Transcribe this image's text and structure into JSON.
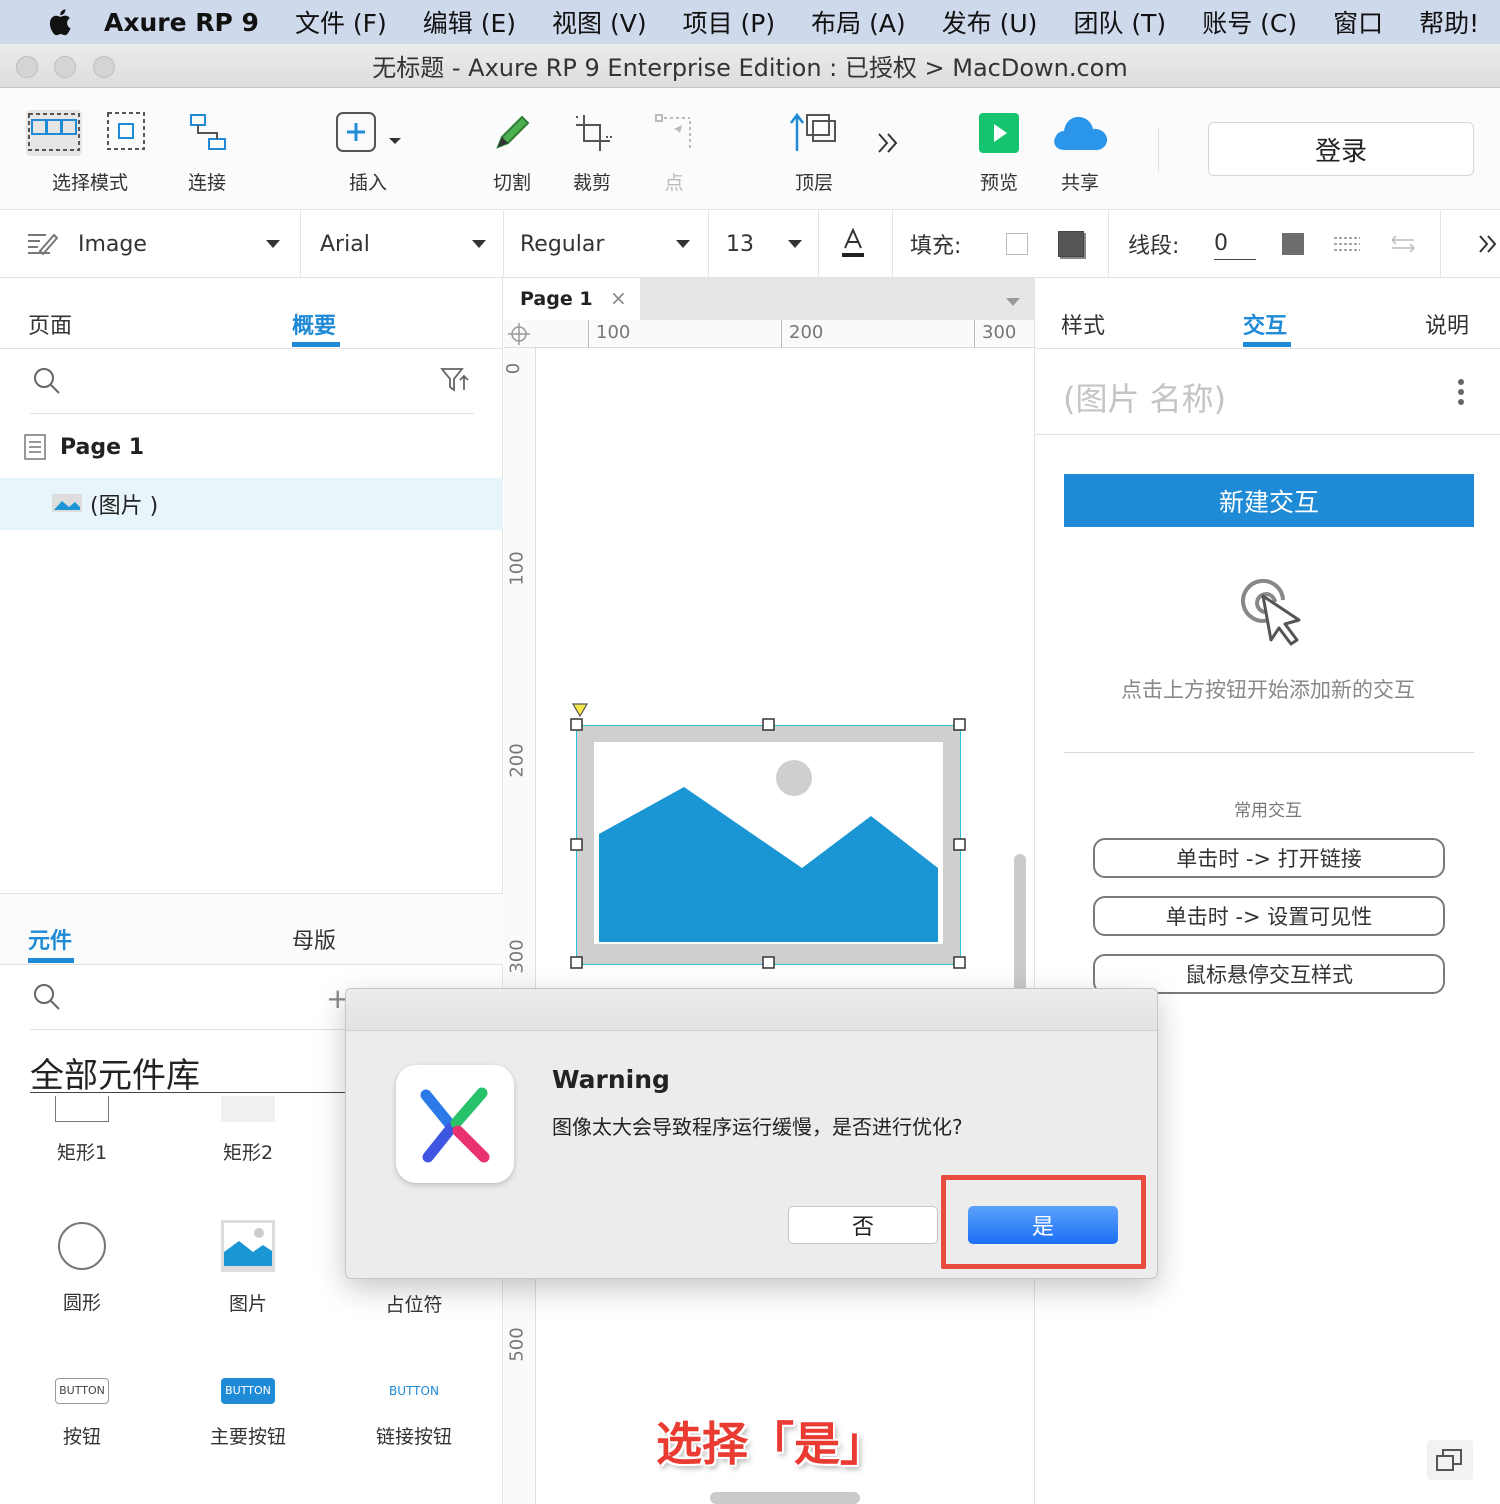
{
  "menubar": {
    "app_name": "Axure RP 9",
    "items": [
      "文件 (F)",
      "编辑 (E)",
      "视图 (V)",
      "项目 (P)",
      "布局 (A)",
      "发布 (U)",
      "团队 (T)",
      "账号 (C)",
      "窗口",
      "帮助!"
    ]
  },
  "window": {
    "title": "无标题 - Axure RP 9 Enterprise Edition : 已授权 > MacDown.com"
  },
  "toolbar": {
    "select_mode": "选择模式",
    "connect": "连接",
    "insert": "插入",
    "cut": "切割",
    "crop": "裁剪",
    "point": "点",
    "top_layer": "顶层",
    "preview": "预览",
    "share": "共享",
    "login": "登录"
  },
  "stylebar": {
    "widget_type": "Image",
    "font": "Arial",
    "font_style": "Regular",
    "font_size": "13",
    "fill_label": "填充:",
    "line_label": "线段:",
    "line_value": "0"
  },
  "left_panel": {
    "tabs": [
      "页面",
      "概要"
    ],
    "active_tab": "概要",
    "page_name": "Page 1",
    "outline_item": "(图片 )",
    "bottom_tabs": [
      "元件",
      "母版"
    ],
    "library_title": "全部元件库",
    "library_items": [
      "矩形1",
      "矩形2",
      "圆形",
      "图片",
      "占位符",
      "按钮",
      "主要按钮",
      "链接按钮"
    ],
    "button_preview_text": "BUTTON"
  },
  "canvas": {
    "tab_label": "Page 1",
    "ruler_top": [
      "100",
      "200",
      "300"
    ],
    "ruler_left": [
      "0",
      "100",
      "200",
      "300",
      "500"
    ],
    "annotation": "选择「是」"
  },
  "right_panel": {
    "tabs": [
      "样式",
      "交互",
      "说明"
    ],
    "active_tab": "交互",
    "widget_name_placeholder": "(图片 名称)",
    "new_interaction": "新建交互",
    "hint": "点击上方按钮开始添加新的交互",
    "common_title": "常用交互",
    "common_items": [
      "单击时 -> 打开链接",
      "单击时 -> 设置可见性",
      "鼠标悬停交互样式"
    ]
  },
  "dialog": {
    "title": "Warning",
    "message": "图像太大会导致程序运行缓慢，是否进行优化?",
    "no_label": "否",
    "yes_label": "是"
  },
  "colors": {
    "accent": "#1f8ad6",
    "image_blue": "#1996d3",
    "highlight": "#ea4b3f",
    "menubar": "#cfd9ec"
  }
}
